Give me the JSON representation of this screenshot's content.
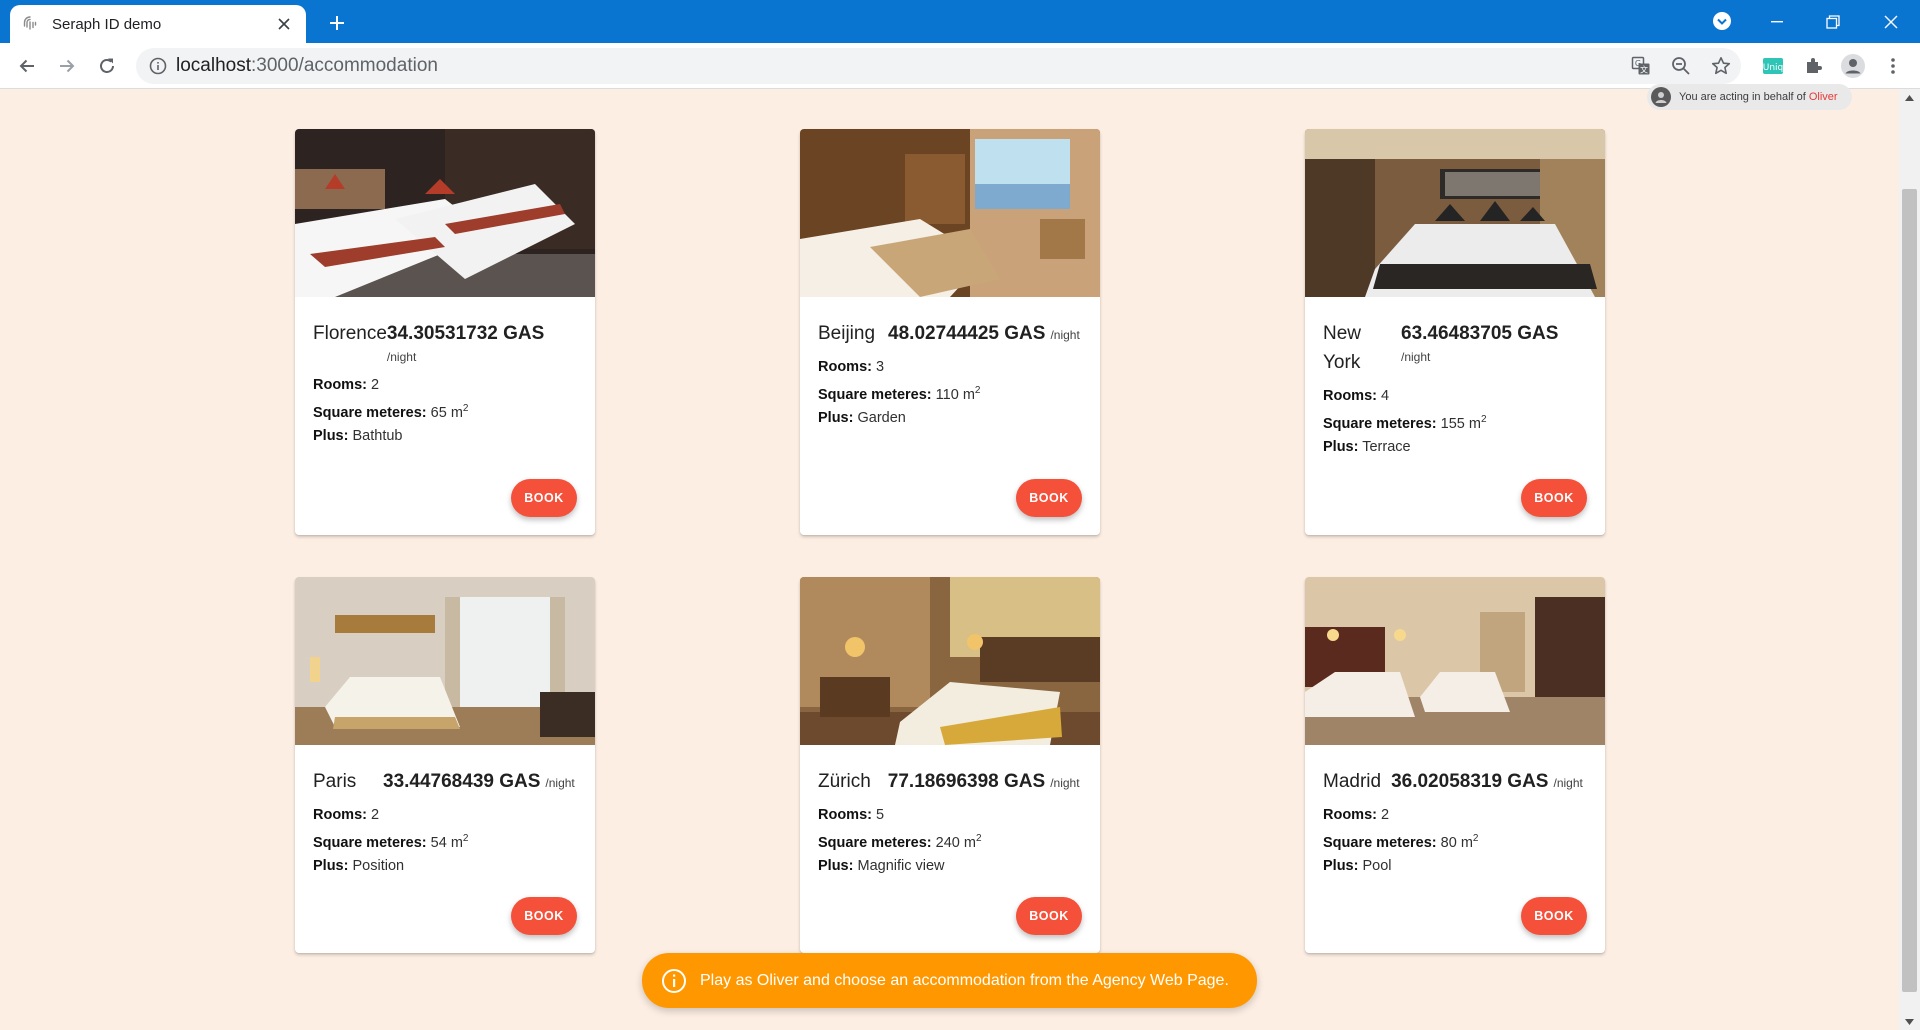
{
  "browser": {
    "tab_title": "Seraph ID demo",
    "url_host": "localhost",
    "url_path": ":3000/accommodation"
  },
  "banner": {
    "prefix": "You are acting in behalf of",
    "name": "Oliver"
  },
  "cards": [
    {
      "city": "Florence",
      "price": "34.30531732 GAS",
      "per": "/night",
      "rooms_label": "Rooms:",
      "rooms": "2",
      "sqm_label": "Square meteres:",
      "sqm": "65 m",
      "sqm_sup": "2",
      "plus_label": "Plus:",
      "plus": "Bathtub",
      "book": "BOOK"
    },
    {
      "city": "Beijing",
      "price": "48.02744425 GAS",
      "per": "/night",
      "rooms_label": "Rooms:",
      "rooms": "3",
      "sqm_label": "Square meteres:",
      "sqm": "110 m",
      "sqm_sup": "2",
      "plus_label": "Plus:",
      "plus": "Garden",
      "book": "BOOK"
    },
    {
      "city": "New York",
      "price": "63.46483705 GAS",
      "per": "/night",
      "rooms_label": "Rooms:",
      "rooms": "4",
      "sqm_label": "Square meteres:",
      "sqm": "155 m",
      "sqm_sup": "2",
      "plus_label": "Plus:",
      "plus": "Terrace",
      "book": "BOOK"
    },
    {
      "city": "Paris",
      "price": "33.44768439 GAS",
      "per": "/night",
      "rooms_label": "Rooms:",
      "rooms": "2",
      "sqm_label": "Square meteres:",
      "sqm": "54 m",
      "sqm_sup": "2",
      "plus_label": "Plus:",
      "plus": "Position",
      "book": "BOOK"
    },
    {
      "city": "Zürich",
      "price": "77.18696398 GAS",
      "per": "/night",
      "rooms_label": "Rooms:",
      "rooms": "5",
      "sqm_label": "Square meteres:",
      "sqm": "240 m",
      "sqm_sup": "2",
      "plus_label": "Plus:",
      "plus": "Magnific view",
      "book": "BOOK"
    },
    {
      "city": "Madrid",
      "price": "36.02058319 GAS",
      "per": "/night",
      "rooms_label": "Rooms:",
      "rooms": "2",
      "sqm_label": "Square meteres:",
      "sqm": "80 m",
      "sqm_sup": "2",
      "plus_label": "Plus:",
      "plus": "Pool",
      "book": "BOOK"
    }
  ],
  "snackbar": {
    "message": "Play as Oliver and choose an accommodation from the Agency Web Page."
  },
  "colors": {
    "titlebar": "#0a74d1",
    "page_background": "#fdeee3",
    "book_button": "#f4503a",
    "snackbar": "#ff9800",
    "acting_name": "#e53935"
  },
  "icons": {
    "tab_favicon": "fingerprint-icon",
    "tab_close": "close-icon",
    "new_tab": "plus-icon",
    "back": "arrow-left-icon",
    "forward": "arrow-right-icon",
    "reload": "reload-icon",
    "site_info": "info-icon",
    "translate": "translate-icon",
    "zoom": "zoom-out-icon",
    "bookmark": "star-icon",
    "extension": "uniq-extension-icon",
    "extensions": "puzzle-icon",
    "profile": "account-icon",
    "menu": "kebab-menu-icon",
    "snackbar": "info-circle-icon"
  }
}
